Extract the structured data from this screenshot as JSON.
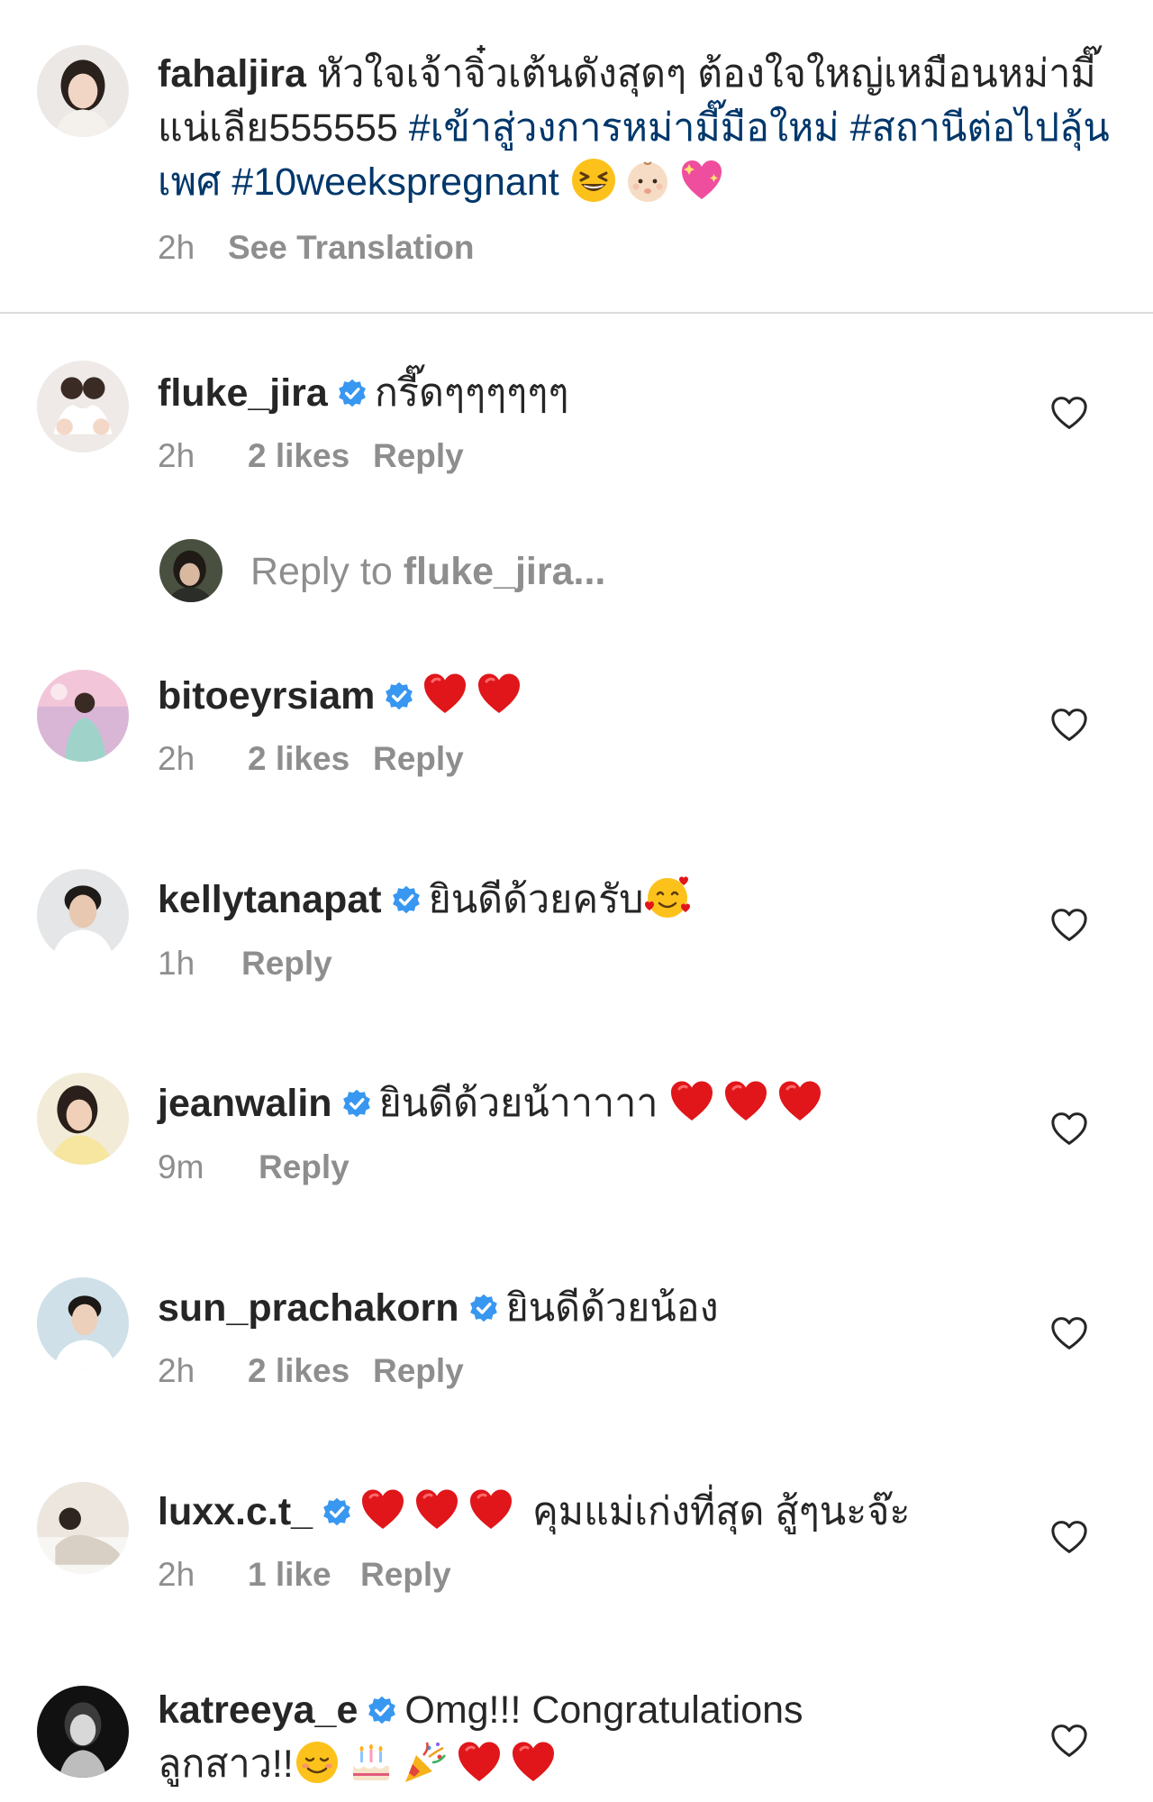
{
  "caption": {
    "username": "fahaljira",
    "text_part1": " หัวใจเจ้าจิ๋วเต้นดังสุดๆ ต้องใจใหญ่เหมือนหม่ามี๊แน่เลีย555555 ",
    "hashtag1": "#เข้าสู่วงการหม่ามี๊มือใหม่",
    "hashtag2": "#สถานีต่อไปลุ้นเพศ",
    "hashtag3": "#10weekspregnant",
    "emojis": [
      "grinning-squinting-face",
      "baby",
      "sparkling-heart"
    ],
    "time": "2h",
    "see_translation": "See Translation"
  },
  "reply_field": {
    "prefix": "Reply to ",
    "target": "fluke_jira..."
  },
  "comments": [
    {
      "username": "fluke_jira",
      "verified": true,
      "text": "กรี๊ดๆๆๆๆๆๆ",
      "emojis": [],
      "time": "2h",
      "likes": "2 likes",
      "reply": "Reply"
    },
    {
      "username": "bitoeyrsiam",
      "verified": true,
      "text": "",
      "emojis": [
        "red-heart",
        "red-heart"
      ],
      "time": "2h",
      "likes": "2 likes",
      "reply": "Reply"
    },
    {
      "username": "kellytanapat",
      "verified": true,
      "text": "ยินดีด้วยครับ",
      "emojis": [
        "smiling-face-with-hearts"
      ],
      "time": "1h",
      "likes": "",
      "reply": "Reply"
    },
    {
      "username": "jeanwalin",
      "verified": true,
      "text": "ยินดีด้วยน้าาาาา",
      "emojis": [
        "red-heart",
        "red-heart",
        "red-heart"
      ],
      "time": "9m",
      "likes": "",
      "reply": "Reply"
    },
    {
      "username": "sun_prachakorn",
      "verified": true,
      "text": "ยินดีด้วยน้อง",
      "emojis": [],
      "time": "2h",
      "likes": "2 likes",
      "reply": "Reply"
    },
    {
      "username": "luxx.c.t_",
      "verified": true,
      "text_after": "คุมแม่เก่งที่สุด สู้ๆนะจ๊ะ",
      "emojis": [
        "red-heart",
        "red-heart",
        "red-heart"
      ],
      "time": "2h",
      "likes": "1 like",
      "reply": "Reply"
    },
    {
      "username": "katreeya_e",
      "verified": true,
      "text": "Omg!!! Congratulations",
      "text_line2": "ลูกสาว!!",
      "emojis": [
        "smiling-face",
        "birthday-cake",
        "party-popper",
        "red-heart",
        "red-heart"
      ],
      "time": "",
      "likes": "",
      "reply": ""
    }
  ],
  "colors": {
    "text": "#262626",
    "meta": "#8e8e8e",
    "hashtag": "#00376b",
    "verified": "#3897f0",
    "divider": "#dbdbdb"
  }
}
